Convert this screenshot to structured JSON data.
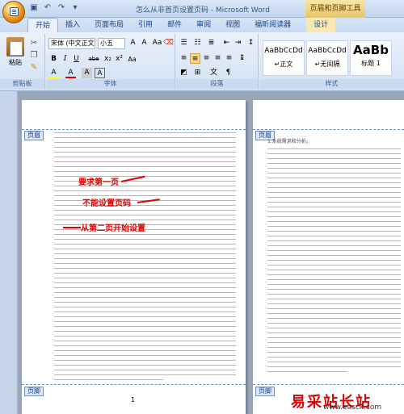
{
  "window": {
    "title": "怎么从非首页设置页码 - Microsoft Word",
    "contextual_group": "页眉和页脚工具"
  },
  "tabs": [
    "开始",
    "插入",
    "页面布局",
    "引用",
    "邮件",
    "审阅",
    "视图",
    "福昕阅读器"
  ],
  "contextual_tab": "设计",
  "ribbon": {
    "clipboard": {
      "paste_label": "粘贴",
      "group_label": "剪贴板"
    },
    "font": {
      "font_name": "宋体 (中文正文)",
      "font_size": "小五",
      "group_label": "字体",
      "buttons": [
        "B",
        "I",
        "U",
        "abe",
        "x₂",
        "x²",
        "Aa",
        "A",
        "A",
        "A",
        "A"
      ]
    },
    "paragraph": {
      "group_label": "段落"
    },
    "styles": {
      "group_label": "样式",
      "items": [
        {
          "preview": "AaBbCcDd",
          "name": "↵正文"
        },
        {
          "preview": "AaBbCcDd",
          "name": "↵无间隔"
        },
        {
          "preview": "AaBb",
          "name": "标题 1"
        }
      ]
    }
  },
  "pages": {
    "header_label": "页眉",
    "footer_label": "页脚",
    "page1_number": "1",
    "page2_heading": "1.系统需求和分析。"
  },
  "annotations": {
    "a1": "要求第一页",
    "a2": "不能设置页码",
    "a3": "从第二页开始设置"
  },
  "watermark": {
    "brand": "易采站长站",
    "url": "www.easck.com"
  },
  "colors": {
    "annotation": "#e10000",
    "contextual_tab": "#fbe7b0",
    "ribbon_bg": "#dbe7f6"
  }
}
